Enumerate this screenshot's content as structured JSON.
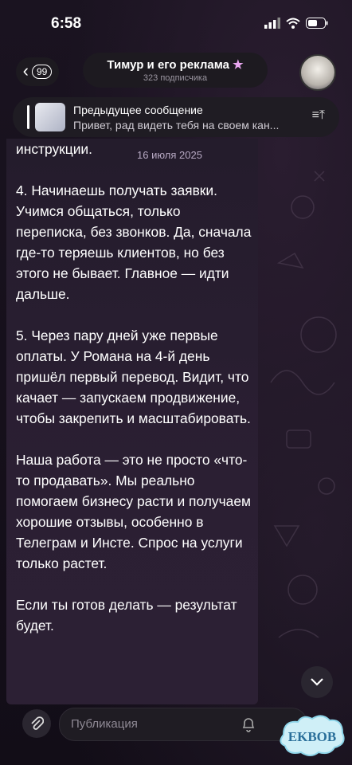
{
  "status_bar": {
    "time": "6:58"
  },
  "header": {
    "back_badge": "99",
    "title": "Тимур и его реклама",
    "subtitle": "323 подписчика"
  },
  "pinned": {
    "title": "Предыдущее сообщение",
    "text": "Привет, рад видеть тебя на своем кан..."
  },
  "message": {
    "date": "16 июля 2025",
    "paragraphs": [
      "инструкции.",
      " 4. Начинаешь получать заявки. Учимся общаться, только переписка, без звонков. Да, сначала где-то теряешь клиентов, но без этого не бывает. Главное — идти дальше.",
      " 5. Через пару дней уже первые оплаты. У Романа на 4-й день пришёл первый перевод. Видит, что качает — запускаем продвижение, чтобы закрепить и масштабировать.",
      "Наша работа — это не просто «что-то продавать». Мы реально помогаем бизнесу расти и получаем хорошие отзывы, особенно в Телеграм и Инсте. Спрос на услуги только растет.",
      "Если ты готов делать — результат будет."
    ]
  },
  "composer": {
    "placeholder": "Публикация"
  },
  "watermark": {
    "text": "EKBOB"
  },
  "colors": {
    "bubble": "#2b1f33",
    "accent": "#b7a9c3",
    "pill": "#1d1a20"
  }
}
